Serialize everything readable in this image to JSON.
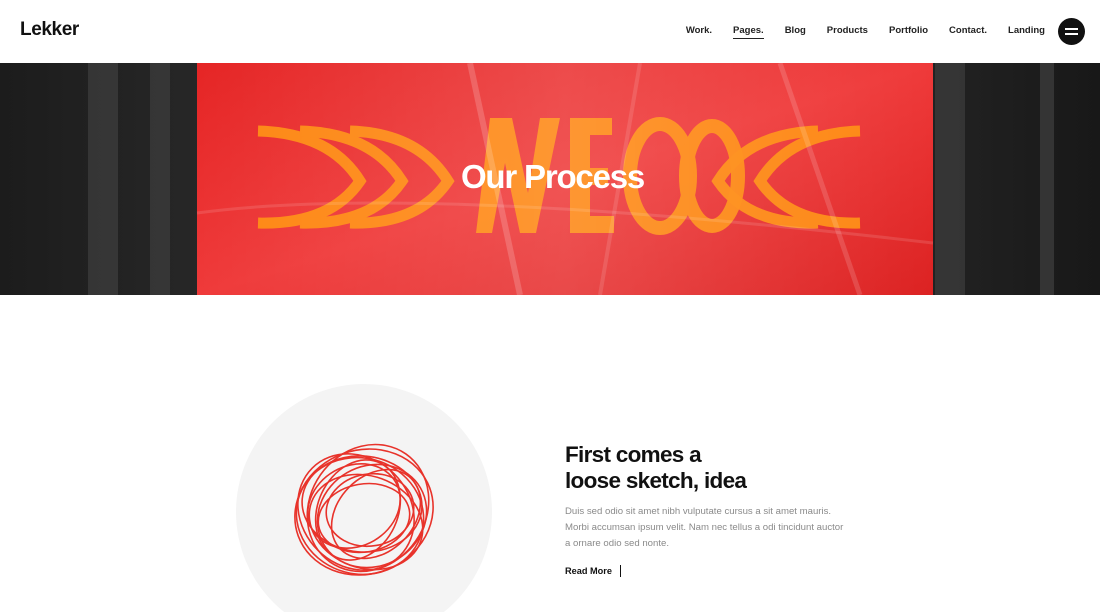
{
  "header": {
    "logo": "Lekker",
    "nav": [
      {
        "label": "Work.",
        "active": false
      },
      {
        "label": "Pages.",
        "active": true
      },
      {
        "label": "Blog",
        "active": false
      },
      {
        "label": "Products",
        "active": false
      },
      {
        "label": "Portfolio",
        "active": false
      },
      {
        "label": "Contact.",
        "active": false
      },
      {
        "label": "Landing",
        "active": false
      }
    ],
    "menu_icon": "hamburger-icon"
  },
  "hero": {
    "title": "Our Process",
    "background_colors": {
      "red": "#e42b2b",
      "orange": "#ff8a0a",
      "dark": "#232323"
    }
  },
  "feature": {
    "title_line1": "First comes a",
    "title_line2": "loose sketch, idea",
    "body": "Duis sed odio sit amet nibh vulputate cursus a sit amet mauris. Morbi accumsan ipsum velit. Nam nec tellus a odi tincidunt auctor a ornare odio sed nonte.",
    "read_more": "Read More",
    "illustration": "scribble-illustration",
    "accent_color": "#e8332b"
  }
}
